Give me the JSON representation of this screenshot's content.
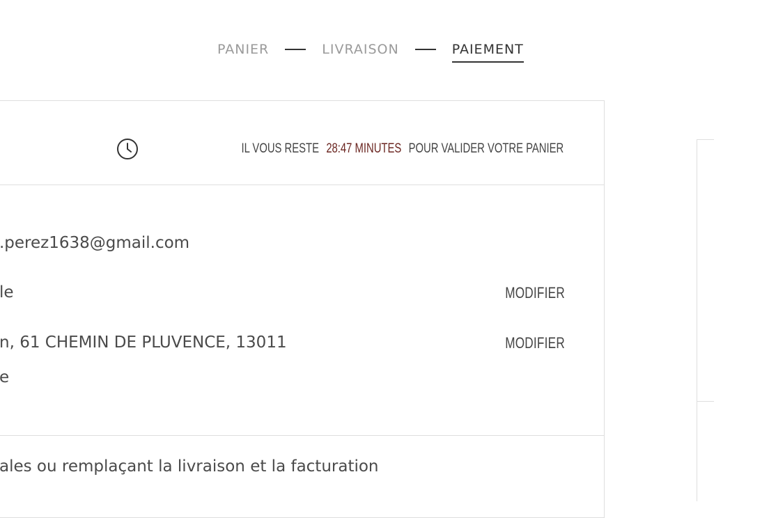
{
  "breadcrumb": {
    "steps": [
      {
        "label": "PANIER"
      },
      {
        "label": "LIVRAISON"
      },
      {
        "label": "PAIEMENT"
      }
    ]
  },
  "timer": {
    "prefix": "IL VOUS RESTE",
    "remaining": "28:47 MINUTES",
    "suffix": "POUR VALIDER VOTRE PANIER",
    "icon": "clock-icon",
    "accent_color": "#6b2621"
  },
  "contact": {
    "email": ".perez1638@gmail.com",
    "shipping_method": "le",
    "address_line1": "n, 61 CHEMIN DE PLUVENCE, 13011",
    "address_line2": "e",
    "modify_label_1": "MODIFIER",
    "modify_label_2": "MODIFIER"
  },
  "next_section": {
    "text": "ales ou remplaçant la livraison et la facturation"
  }
}
